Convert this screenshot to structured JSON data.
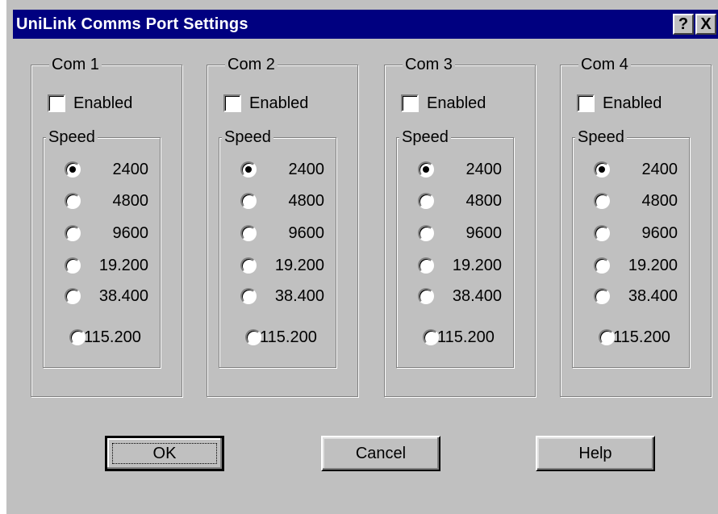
{
  "window": {
    "title": "UniLink Comms Port Settings",
    "help_glyph": "?",
    "close_glyph": "X"
  },
  "ports": [
    {
      "label": "Com 1",
      "enabled_label": "Enabled",
      "enabled": false,
      "speed_label": "Speed",
      "selected_speed": "2400"
    },
    {
      "label": "Com 2",
      "enabled_label": "Enabled",
      "enabled": false,
      "speed_label": "Speed",
      "selected_speed": "2400"
    },
    {
      "label": "Com 3",
      "enabled_label": "Enabled",
      "enabled": false,
      "speed_label": "Speed",
      "selected_speed": "2400"
    },
    {
      "label": "Com 4",
      "enabled_label": "Enabled",
      "enabled": false,
      "speed_label": "Speed",
      "selected_speed": "2400"
    }
  ],
  "speeds": [
    "2400",
    "4800",
    "9600",
    "19.200",
    "38.400",
    "115.200"
  ],
  "buttons": {
    "ok": "OK",
    "cancel": "Cancel",
    "help": "Help"
  },
  "colors": {
    "titlebar": "#000080",
    "face": "#c0c0c0"
  }
}
